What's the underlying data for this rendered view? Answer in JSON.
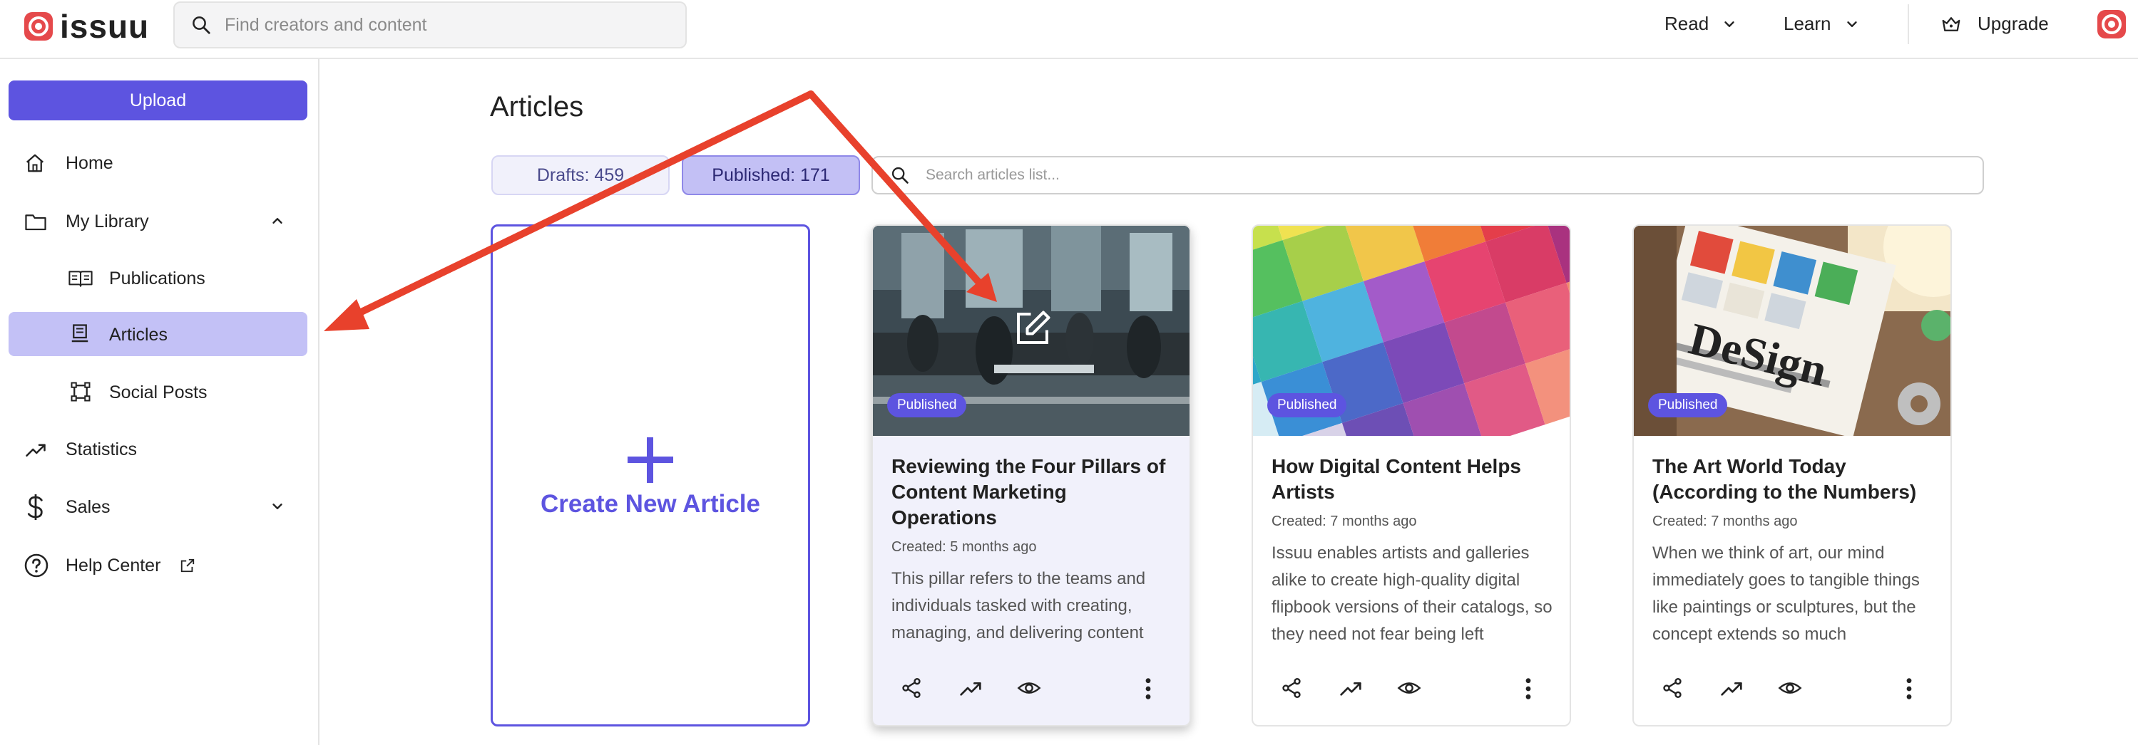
{
  "header": {
    "logo_text": "issuu",
    "search_placeholder": "Find creators and content",
    "read_label": "Read",
    "learn_label": "Learn",
    "upgrade_label": "Upgrade"
  },
  "sidebar": {
    "upload_label": "Upload",
    "items": [
      {
        "label": "Home",
        "icon": "home-icon"
      },
      {
        "label": "My Library",
        "icon": "folder-icon"
      },
      {
        "label": "Publications",
        "icon": "book-icon"
      },
      {
        "label": "Articles",
        "icon": "article-icon",
        "active": true
      },
      {
        "label": "Social Posts",
        "icon": "social-post-icon"
      },
      {
        "label": "Statistics",
        "icon": "trend-icon"
      },
      {
        "label": "Sales",
        "icon": "dollar-icon"
      },
      {
        "label": "Help Center",
        "icon": "help-icon"
      }
    ]
  },
  "main": {
    "title": "Articles",
    "tabs": {
      "drafts": "Drafts: 459",
      "published": "Published: 171"
    },
    "search_placeholder": "Search articles list...",
    "create_label": "Create New Article",
    "articles": [
      {
        "badge": "Published",
        "title": "Reviewing the Four Pillars of Content Marketing Operations",
        "created": "Created: 5 months ago",
        "excerpt": "This pillar refers to the teams and individuals tasked with creating, managing, and delivering content"
      },
      {
        "badge": "Published",
        "title": "How Digital Content Helps Artists",
        "created": "Created: 7 months ago",
        "excerpt": "Issuu enables artists and galleries alike to create high-quality digital flipbook versions of their catalogs, so they need not fear being left"
      },
      {
        "badge": "Published",
        "title": "The Art World Today (According to the Numbers)",
        "created": "Created: 7 months ago",
        "excerpt": "When we think of art, our mind immediately goes to tangible things like paintings or sculptures, but the concept extends so much"
      }
    ],
    "thumb3_text": "DeSign"
  },
  "colors": {
    "accent": "#5d54e0",
    "active_bg": "#c3c1f6",
    "brand": "#e5494b",
    "annotation_arrow": "#e8412c"
  }
}
